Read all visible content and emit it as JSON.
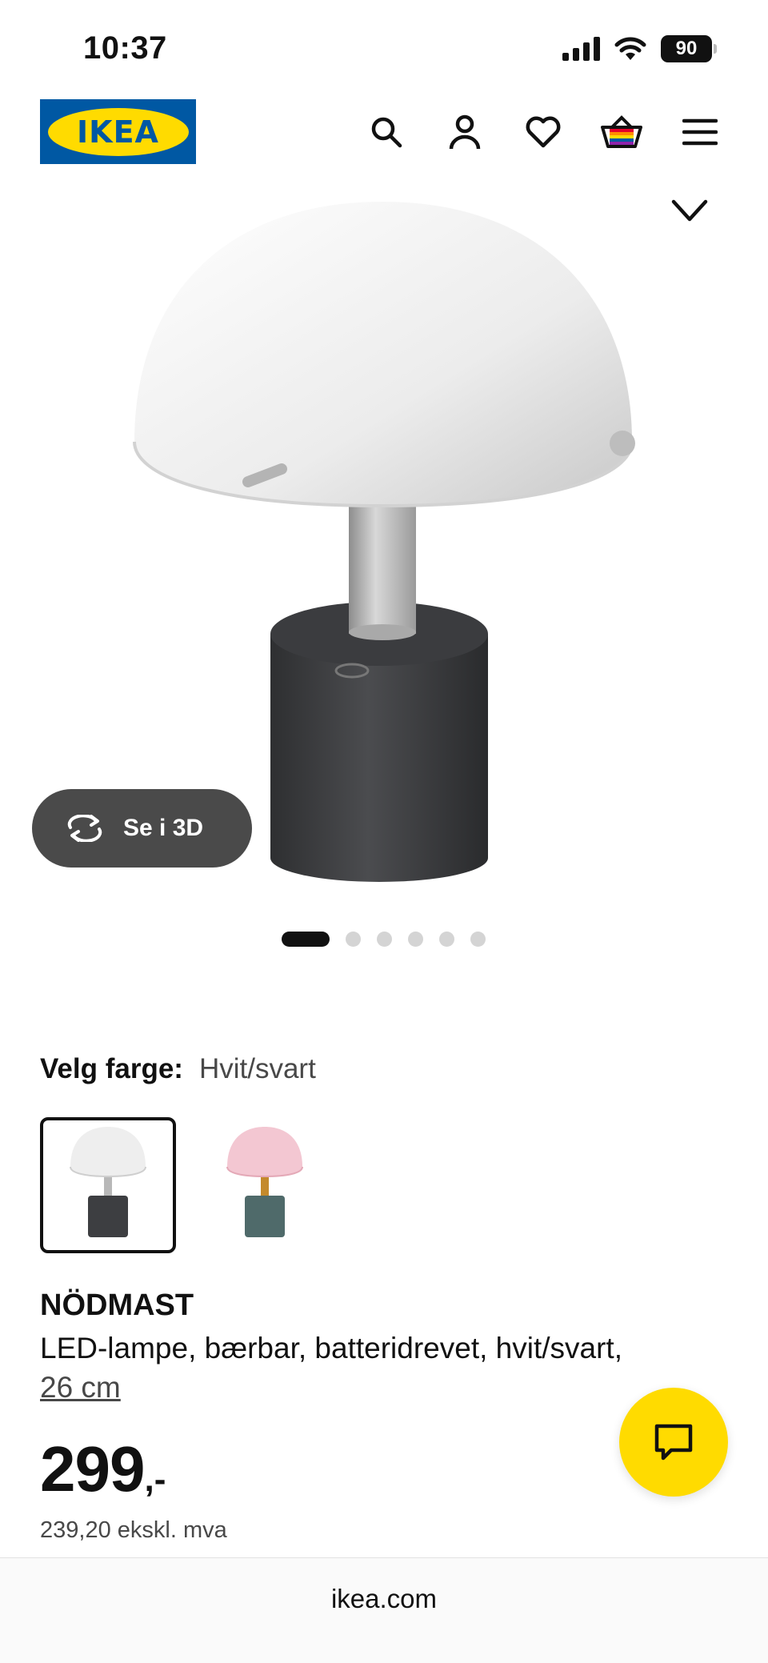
{
  "status_bar": {
    "time": "10:37",
    "battery": "90",
    "icons": [
      "signal-icon",
      "wifi-icon",
      "battery-icon"
    ]
  },
  "header": {
    "logo_text": "IKEA",
    "icons": [
      "search-icon",
      "account-icon",
      "wishlist-heart-icon",
      "basket-icon",
      "menu-icon"
    ]
  },
  "gallery": {
    "view_3d_label": "Se i 3D",
    "image_count": 6,
    "active_index": 0
  },
  "color_select": {
    "label": "Velg farge:",
    "value": "Hvit/svart",
    "options": [
      "white-black",
      "pink-green"
    ],
    "selected_index": 0
  },
  "product": {
    "name": "NÖDMAST",
    "description": "LED-lampe, bærbar, batteridrevet, hvit/svart,",
    "size": "26 cm"
  },
  "price": {
    "amount": "299",
    "suffix": ",-",
    "ex_vat": "239,20 ekskl. mva"
  },
  "browser": {
    "url": "ikea.com"
  },
  "colors": {
    "ikea_blue": "#0058a3",
    "ikea_yellow": "#ffdb00",
    "button_dark": "#4a4a4a"
  }
}
